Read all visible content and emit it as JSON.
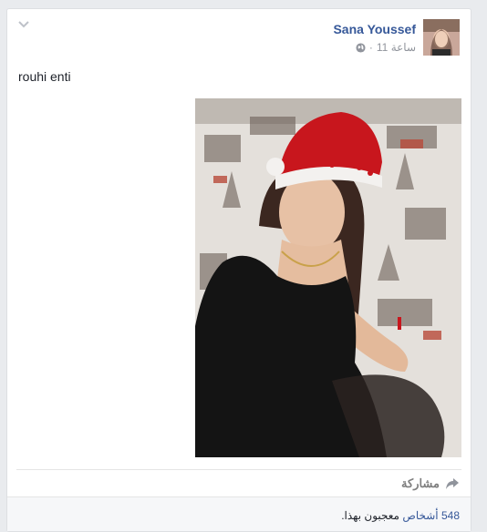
{
  "post": {
    "author": "Sana Youssef",
    "time": "11 ساعة",
    "separator": "·",
    "text": "rouhi enti"
  },
  "icons": {
    "menu": "chevron-down-icon",
    "privacy": "globe-icon",
    "share": "share-arrow-icon"
  },
  "actions": {
    "share_label": "مشاركة"
  },
  "likes": {
    "count_text": "548 أشخاص",
    "suffix": " معجبون بهذا."
  },
  "colors": {
    "link": "#365899",
    "meta": "#90949c",
    "text": "#1d2129",
    "background": "#e9ebee"
  }
}
